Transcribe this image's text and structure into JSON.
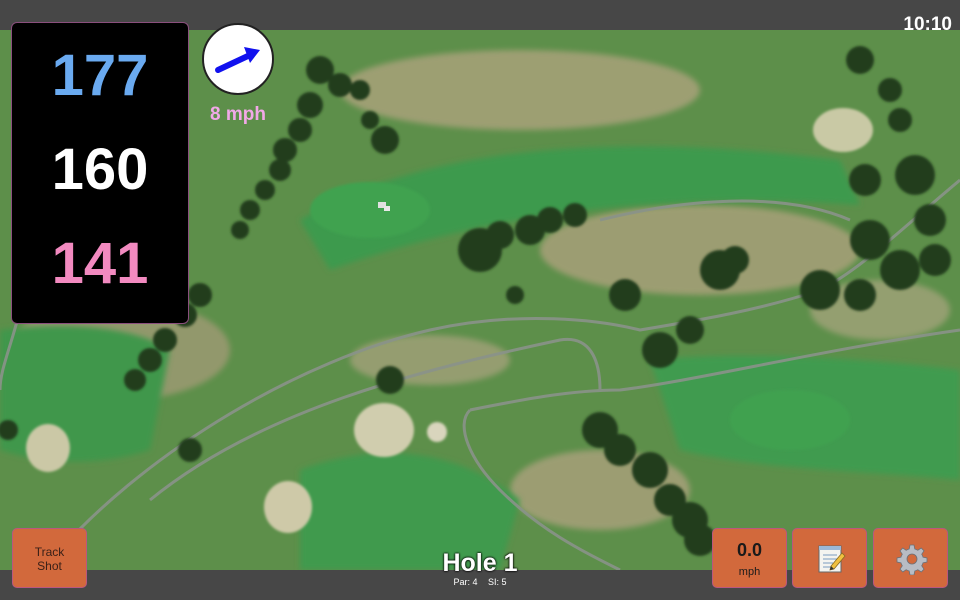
{
  "status_bar": {
    "time": "10:10"
  },
  "distances": {
    "back": {
      "value": "177",
      "color": "#6aaaf0"
    },
    "middle": {
      "value": "160",
      "color": "#ffffff"
    },
    "front": {
      "value": "141",
      "color": "#f28ac0"
    }
  },
  "wind": {
    "speed_label": "8 mph",
    "arrow_color": "#1111ee",
    "label_color": "#f2a8e8"
  },
  "map": {
    "description_icon": "satellite-course-map"
  },
  "buttons": {
    "track_shot": {
      "label_line1": "Track",
      "label_line2": "Shot",
      "color": "#d2693c"
    },
    "speed": {
      "value": "0.0",
      "unit": "mph"
    },
    "notes": {
      "icon": "notepad-icon"
    },
    "settings": {
      "icon": "gear-icon"
    }
  },
  "hole": {
    "title": "Hole 1",
    "par_label": "Par: 4",
    "si_label": "SI: 5"
  }
}
